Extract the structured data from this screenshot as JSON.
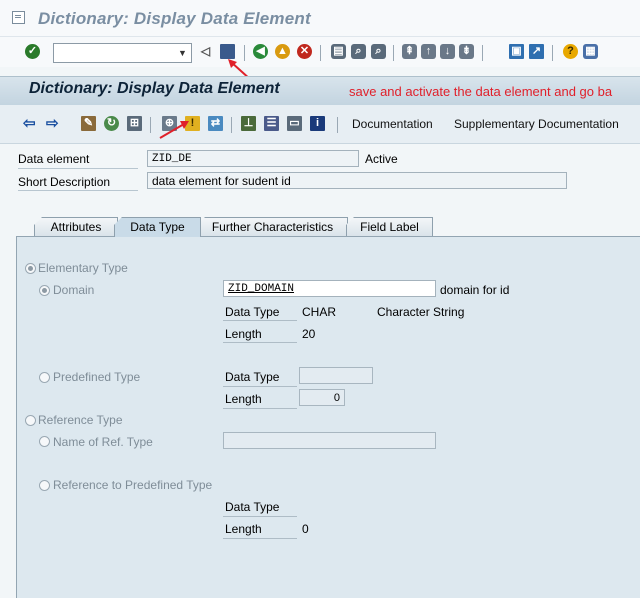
{
  "window": {
    "title": "Dictionary: Display Data Element"
  },
  "toolbar": {
    "command_field_value": ""
  },
  "header": {
    "title": "Dictionary: Display Data Element",
    "annotation": "save and activate the data element and go ba"
  },
  "app_toolbar": {
    "documentation_label": "Documentation",
    "supplementary_label": "Supplementary Documentation"
  },
  "fields": {
    "data_element_label": "Data element",
    "data_element_value": "ZID_DE",
    "status": "Active",
    "short_description_label": "Short Description",
    "short_description_value": "data element for sudent id"
  },
  "tabs": [
    {
      "label": "Attributes",
      "active": false
    },
    {
      "label": "Data Type",
      "active": true
    },
    {
      "label": "Further Characteristics",
      "active": false
    },
    {
      "label": "Field Label",
      "active": false
    }
  ],
  "data_type_tab": {
    "elementary_type_label": "Elementary Type",
    "domain_label": "Domain",
    "domain_value": "ZID_DOMAIN",
    "domain_description": "domain for id",
    "data_type_label": "Data Type",
    "data_type_value": "CHAR",
    "data_type_description": "Character String",
    "length_label": "Length",
    "length_value": "20",
    "predefined_type_label": "Predefined Type",
    "predefined_data_type_label": "Data Type",
    "predefined_length_label": "Length",
    "predefined_length_value": "0",
    "reference_type_label": "Reference Type",
    "ref_type_name_label": "Name of Ref. Type",
    "ref_predefined_label": "Reference to Predefined Type",
    "ref_data_type_label": "Data Type",
    "ref_length_label": "Length",
    "ref_length_value": "0"
  },
  "colors": {
    "annotation": "#e0202a",
    "panel_bg": "#dde8ef",
    "header_bg": "#c3d4e0"
  }
}
